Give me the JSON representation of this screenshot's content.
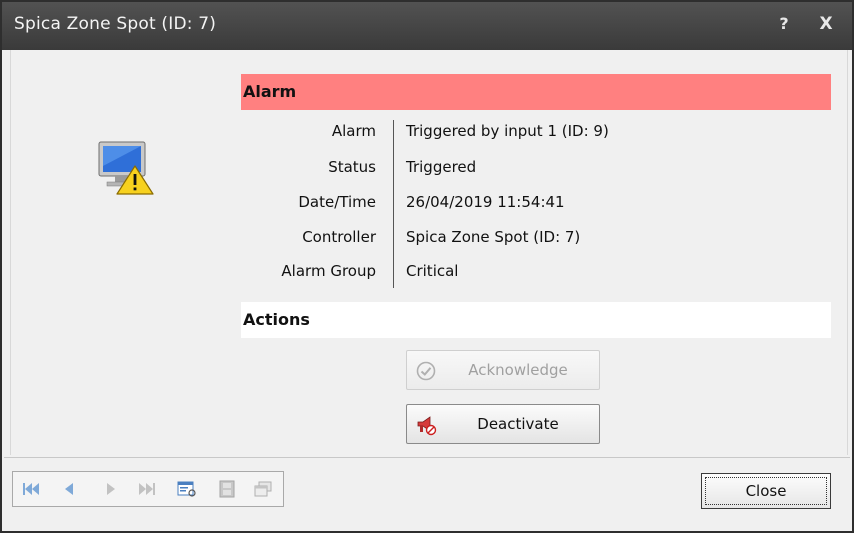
{
  "window": {
    "title": "Spica Zone Spot (ID: 7)",
    "help_glyph": "?",
    "close_glyph": "X"
  },
  "alarm_section": {
    "header": "Alarm",
    "header_color": "#ff8080",
    "fields": [
      {
        "label": "Alarm",
        "value": "Triggered by input 1 (ID: 9)"
      },
      {
        "label": "Status",
        "value": "Triggered"
      },
      {
        "label": "Date/Time",
        "value": "26/04/2019 11:54:41"
      },
      {
        "label": "Controller",
        "value": "Spica Zone Spot (ID: 7)"
      },
      {
        "label": "Alarm Group",
        "value": "Critical"
      }
    ]
  },
  "actions_section": {
    "header": "Actions",
    "acknowledge_label": "Acknowledge",
    "deactivate_label": "Deactivate"
  },
  "footer": {
    "close_label": "Close",
    "nav_icons": [
      "first-record-icon",
      "previous-record-icon",
      "next-record-icon",
      "last-record-icon",
      "details-view-icon",
      "film-strip-icon",
      "windows-icon"
    ]
  }
}
